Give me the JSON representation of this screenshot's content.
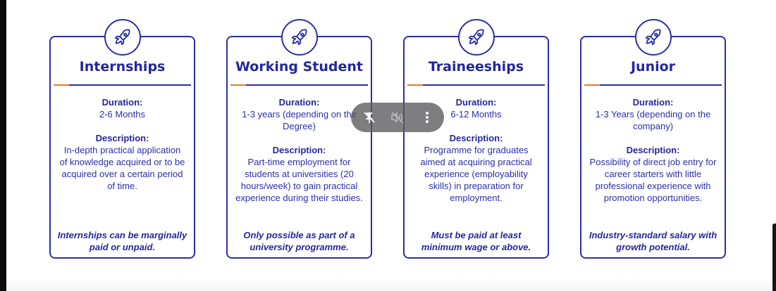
{
  "cards": [
    {
      "title": "Internships",
      "duration_label": "Duration:",
      "duration": "2-6 Months",
      "description_label": "Description:",
      "description": "In-depth practical application of knowledge acquired or to be acquired over a certain period of time.",
      "footer": "Internships can be marginally paid or unpaid.",
      "icon": "rocket-icon"
    },
    {
      "title": "Working Student",
      "duration_label": "Duration:",
      "duration": "1-3 years (depending on the Degree)",
      "description_label": "Description:",
      "description": "Part-time employment for students at universities (20 hours/week) to gain practical experience during their studies.",
      "footer": "Only possible as part of a university programme.",
      "icon": "rocket-icon"
    },
    {
      "title": "Traineeships",
      "duration_label": "Duration:",
      "duration": "6-12 Months",
      "description_label": "Description:",
      "description": "Programme for graduates aimed at acquiring practical experience (employability skills) in preparation for employment.",
      "footer": "Must be paid at least minimum wage or above.",
      "icon": "rocket-icon"
    },
    {
      "title": "Junior",
      "duration_label": "Duration:",
      "duration": "1-3 Years (depending on the company)",
      "description_label": "Description:",
      "description": "Possibility of direct job entry for career starters with little professional experience with promotion opportunities.",
      "footer": "Industry-standard salary with growth potential.",
      "icon": "rocket-icon"
    }
  ],
  "video_controls": {
    "pin_icon": "unpin-icon",
    "mute_icon": "muted-speaker-icon",
    "menu_icon": "more-vertical-icon"
  },
  "colors": {
    "primary": "#2a2fa8",
    "accent": "#e8792b",
    "overlay": "#5a5a5c"
  }
}
